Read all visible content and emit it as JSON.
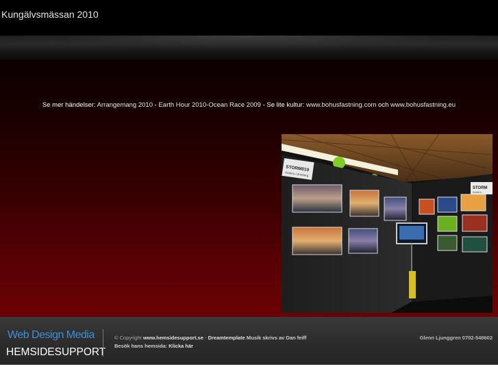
{
  "site": {
    "title": "Kungälvsmässan 2010"
  },
  "events": {
    "label": "Se mer händelser:",
    "link1": "Arrangemang 2010",
    "sep1": " - ",
    "link2": "Earth Hour 2010",
    "sep2": "-",
    "link3": "Ocean Race 2009",
    "sep3": " - ",
    "culture_label": "Se lite kultur:",
    "link4": "www.bohusfastning.com",
    "and": "och",
    "link5": "www.bohusfastning.eu"
  },
  "photo": {
    "sign_left_line1": "STORM010",
    "sign_left_line2": "Anders Lönnberg",
    "sign_right_line1": "STORM",
    "sign_right_line2": "Anders"
  },
  "footer": {
    "brand_top": "Web Design Media",
    "brand_bottom": "HEMSIDESUPPORT",
    "copyright": "© Copyright",
    "site_link": "www.hemsidesupport.se",
    "sep": "-",
    "template_link": "Dreamtemplate",
    "music_text": "Musik skrivs av Dan feiff",
    "visit_text": "Besök hans hemsida:",
    "click_link": "Klicka här",
    "contact": "Glenn Ljunggren 0702-548602"
  },
  "colors": {
    "brand_blue": "#3f8fd6",
    "red_bg": "#5a0103"
  }
}
